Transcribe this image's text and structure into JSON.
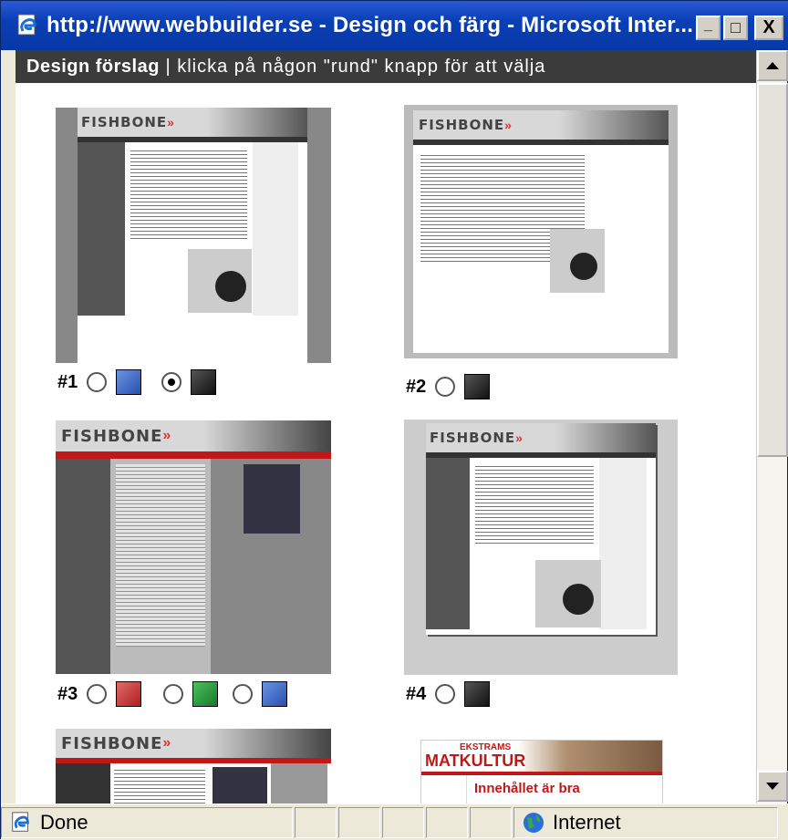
{
  "window": {
    "title": "http://www.webbuilder.se - Design och färg - Microsoft Inter...",
    "minimize_label": "_",
    "maximize_label": "□",
    "close_label": "X"
  },
  "header": {
    "bold": "Design förslag",
    "rest": " | klicka på någon \"rund\" knapp för att välja"
  },
  "designs": [
    {
      "number": "#1",
      "options": [
        {
          "color": "#3a64c8",
          "selected": false
        },
        {
          "color": "#2b2b2b",
          "selected": true
        }
      ],
      "logo": "FISHBONE"
    },
    {
      "number": "#2",
      "options": [
        {
          "color": "#2b2b2b",
          "selected": false
        }
      ],
      "logo": "FISHBONE"
    },
    {
      "number": "#3",
      "options": [
        {
          "color": "#c43a3a",
          "selected": false
        },
        {
          "color": "#1f8a3b",
          "selected": false
        },
        {
          "color": "#3a64c8",
          "selected": false
        }
      ],
      "logo": "FISHBONE"
    },
    {
      "number": "#4",
      "options": [
        {
          "color": "#2b2b2b",
          "selected": false
        }
      ],
      "logo": "FISHBONE"
    }
  ],
  "partial": {
    "left_logo": "FISHBONE",
    "right_brand": "MATKULTUR",
    "right_brand_top": "EKSTRAMS",
    "right_heading": "Innehållet är bra"
  },
  "status": {
    "text": "Done",
    "zone": "Internet"
  },
  "icons": {
    "app": "ie-page-icon",
    "status": "ie-page-icon",
    "zone": "globe-icon"
  }
}
